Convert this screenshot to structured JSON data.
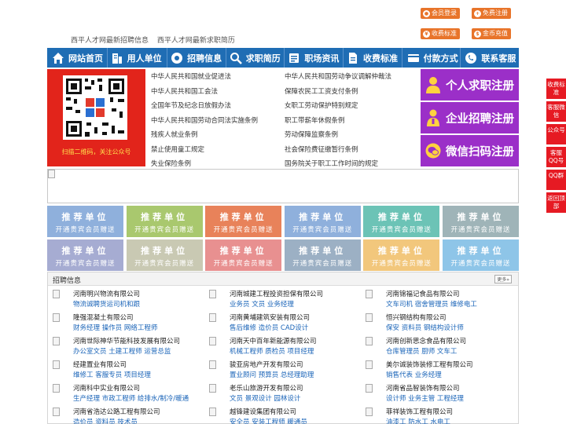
{
  "header": {
    "links": [
      "西平人才网最新招聘信息",
      "西平人才网最新求职简历"
    ],
    "buttons": [
      {
        "label": "会员登录",
        "icon": "user-icon"
      },
      {
        "label": "免费注册",
        "icon": "register-icon"
      },
      {
        "label": "收费标准",
        "icon": "price-icon"
      },
      {
        "label": "金币充值",
        "icon": "coin-icon"
      }
    ]
  },
  "nav": [
    {
      "label": "网站首页",
      "icon": "home-icon"
    },
    {
      "label": "用人单位",
      "icon": "building-icon"
    },
    {
      "label": "招聘信息",
      "icon": "broadcast-icon"
    },
    {
      "label": "求职简历",
      "icon": "search-icon"
    },
    {
      "label": "职场资讯",
      "icon": "news-icon"
    },
    {
      "label": "收费标准",
      "icon": "document-icon"
    },
    {
      "label": "付款方式",
      "icon": "payment-icon"
    },
    {
      "label": "联系客服",
      "icon": "phone-icon"
    }
  ],
  "qr": {
    "caption": "扫描二维码，关注公众号"
  },
  "policy_links": [
    [
      "中华人民共和国就业促进法",
      "中华人民共和国劳动争议调解仲裁法"
    ],
    [
      "中华人民共和国工会法",
      "保障农民工工资支付条例"
    ],
    [
      "全国年节及纪念日放假办法",
      "女职工劳动保护特别规定"
    ],
    [
      "中华人民共和国劳动合同法实施条例",
      "职工带薪年休假条例"
    ],
    [
      "残疾人就业条例",
      "劳动保障监察条例"
    ],
    [
      "禁止使用童工规定",
      "社会保险费征缴暂行条例"
    ],
    [
      "失业保险条例",
      "国务院关于职工工作时间的规定"
    ]
  ],
  "register": [
    {
      "label": "个人求职注册",
      "icon": "person-icon"
    },
    {
      "label": "企业招聘注册",
      "icon": "company-icon"
    },
    {
      "label": "微信扫码注册",
      "icon": "wechat-icon"
    }
  ],
  "tiles": {
    "title": "推荐单位",
    "subtitle": "开通贵宾会员赠送",
    "colors": [
      "#8fb0dc",
      "#a9c86e",
      "#e8825a",
      "#8fb0dc",
      "#6cc3b6",
      "#9fb4b8",
      "#a6acd2",
      "#c9c9b3",
      "#e89090",
      "#9cb0c4",
      "#f2c77c",
      "#8ec5e8"
    ]
  },
  "recruit": {
    "title": "招聘信息",
    "more": "更多»",
    "companies": [
      {
        "name": "河南明兴物流有限公司",
        "jobs": "物流诚聘货运司机和跟"
      },
      {
        "name": "河南城建工程投资担保有限公司",
        "jobs": "业务员 文员 业务经理"
      },
      {
        "name": "河南锦福记食品有限公司",
        "jobs": "文车司机 宿舍管理员 维修电工"
      },
      {
        "name": "隆强混凝土有限公司",
        "jobs": "财务经理 操作员 网络工程师"
      },
      {
        "name": "河南黄埔建筑安装有限公司",
        "jobs": "售后维修 造价员 CAD设计"
      },
      {
        "name": "恒兴钢结构有限公司",
        "jobs": "保安 资料员 钢结构设计师"
      },
      {
        "name": "河南世际神华节能科技发展有限公司",
        "jobs": "办公室文员 土建工程师 运营总监"
      },
      {
        "name": "河南天中百年新能源有限公司",
        "jobs": "机械工程师 质检员 项目经理"
      },
      {
        "name": "河南创新思念食品有限公司",
        "jobs": "仓库管理员 厨师 文车工"
      },
      {
        "name": "经建置业有限公司",
        "jobs": "维修工 客服专员 项目经理"
      },
      {
        "name": "骏亚房地产开发有限公司",
        "jobs": "置业顾问 预算员 总经理助理"
      },
      {
        "name": "美尔诚装饰装修工程有限公司",
        "jobs": "销售代表 业务经理"
      },
      {
        "name": "河南科中实业有限公司",
        "jobs": "生产经理 市政工程师 给排水/制冷/暖通"
      },
      {
        "name": "老乐山旅游开发有限公司",
        "jobs": "文员 景观设计 园林设计"
      },
      {
        "name": "河南省品智装饰有限公司",
        "jobs": "设计师 业务主管 工程经理"
      },
      {
        "name": "河南省浩达公路工程有限公司",
        "jobs": "造价员 资料员 技术员"
      },
      {
        "name": "越锋建设集团有限公司",
        "jobs": "安全员 安装工程师 暖通员"
      },
      {
        "name": "菲祥装饰工程有限公司",
        "jobs": "油漆工 防水工 水电工"
      }
    ]
  },
  "side": [
    "收费标准",
    "客服微信",
    "公众号",
    "客服QQ号",
    "QQ群",
    "返回顶部"
  ]
}
